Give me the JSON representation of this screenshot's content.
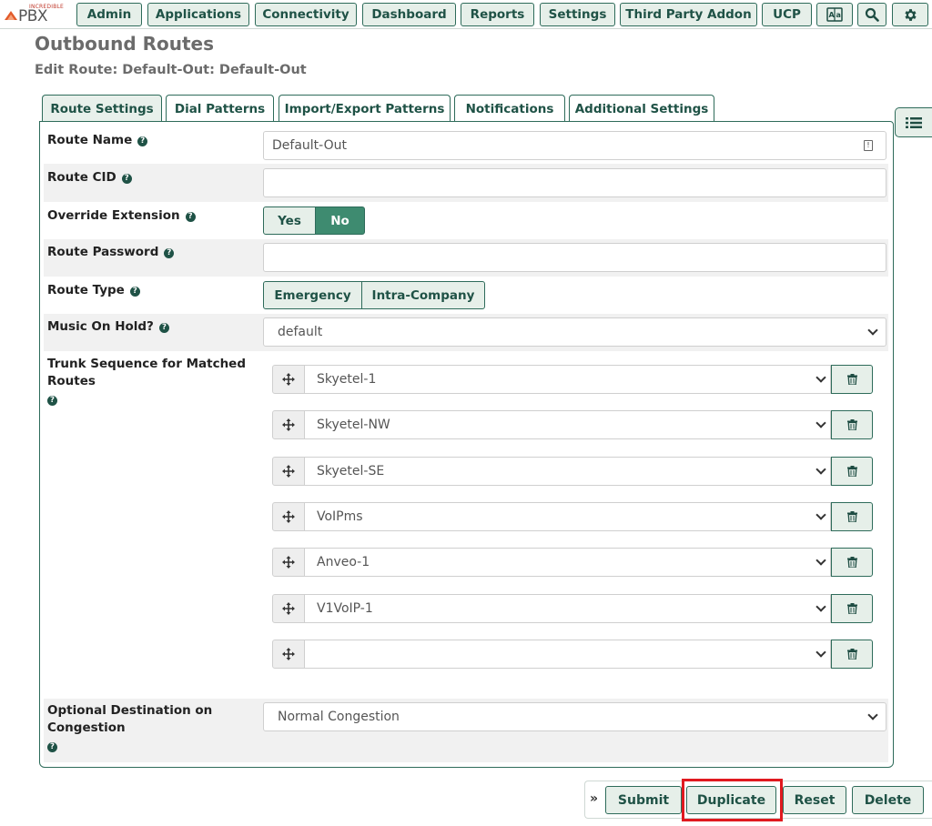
{
  "logo": {
    "small": "INCREDIBLE",
    "big": "PBX"
  },
  "nav": {
    "admin": "Admin",
    "applications": "Applications",
    "connectivity": "Connectivity",
    "dashboard": "Dashboard",
    "reports": "Reports",
    "settings": "Settings",
    "third_party": "Third Party Addon",
    "ucp": "UCP"
  },
  "page": {
    "title": "Outbound Routes",
    "subtitle": "Edit Route: Default-Out: Default-Out"
  },
  "tabs": [
    {
      "label": "Route Settings",
      "active": true
    },
    {
      "label": "Dial Patterns"
    },
    {
      "label": "Import/Export Patterns"
    },
    {
      "label": "Notifications"
    },
    {
      "label": "Additional Settings"
    }
  ],
  "form": {
    "route_name": {
      "label": "Route Name",
      "value": "Default-Out"
    },
    "route_cid": {
      "label": "Route CID",
      "value": ""
    },
    "override_extension": {
      "label": "Override Extension",
      "yes": "Yes",
      "no": "No",
      "selected": "No"
    },
    "route_password": {
      "label": "Route Password",
      "value": ""
    },
    "route_type": {
      "label": "Route Type",
      "emergency": "Emergency",
      "intra": "Intra-Company"
    },
    "music_on_hold": {
      "label": "Music On Hold?",
      "value": "default"
    },
    "trunk_sequence": {
      "label_line1": "Trunk Sequence for Matched",
      "label_line2": "Routes",
      "trunks": [
        "Skyetel-1",
        "Skyetel-NW",
        "Skyetel-SE",
        "VoIPms",
        "Anveo-1",
        "V1VoIP-1",
        ""
      ]
    },
    "optional_destination": {
      "label_line1": "Optional Destination on",
      "label_line2": "Congestion",
      "value": "Normal Congestion"
    }
  },
  "actions": {
    "submit": "Submit",
    "duplicate": "Duplicate",
    "reset": "Reset",
    "delete": "Delete"
  },
  "colors": {
    "accent": "#1f5246",
    "button_bg": "#e6efe9",
    "active_toggle": "#3e8b70",
    "highlight": "#e0191f"
  },
  "icons": [
    "translate-icon",
    "search-icon",
    "gear-icon",
    "list-icon",
    "move-icon",
    "trash-icon",
    "help-icon",
    "key-icon",
    "chevron-down-icon",
    "double-chevron-right-icon"
  ]
}
